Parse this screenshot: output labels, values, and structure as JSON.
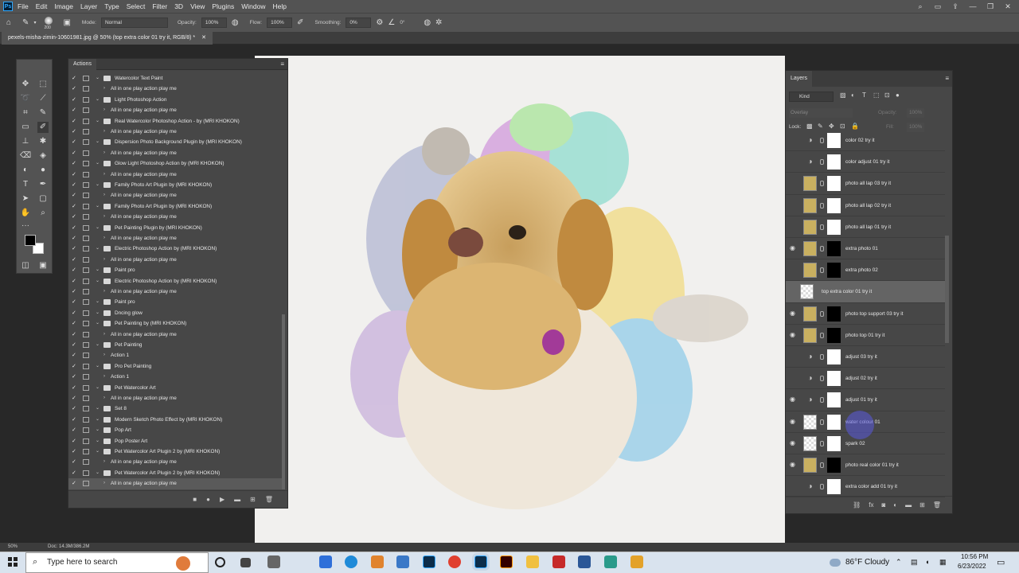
{
  "app": {
    "menu": [
      "File",
      "Edit",
      "Image",
      "Layer",
      "Type",
      "Select",
      "Filter",
      "3D",
      "View",
      "Plugins",
      "Window",
      "Help"
    ]
  },
  "options": {
    "mode_label": "Mode:",
    "mode_value": "Normal",
    "opacity_label": "Opacity:",
    "opacity_value": "100%",
    "flow_label": "Flow:",
    "flow_value": "100%",
    "smoothing_label": "Smoothing:",
    "smoothing_value": "0%",
    "angle_value": "0°",
    "brush_size": "200"
  },
  "document": {
    "tab_title": "pexels-misha-zimin-10601981.jpg @ 50% (top extra color 01 try it, RGB/8) *"
  },
  "actions_panel": {
    "title": "Actions",
    "rows": [
      {
        "label": "Watercolor Text Paint",
        "type": "set",
        "checked": true
      },
      {
        "label": "All in one play action play me",
        "type": "action",
        "checked": true
      },
      {
        "label": "Light Photoshop Action",
        "type": "set",
        "checked": true
      },
      {
        "label": "All in one play action play me",
        "type": "action",
        "checked": true
      },
      {
        "label": "Real Watercolor Photoshop Action - by (MRI KHOKON)",
        "type": "set",
        "checked": true
      },
      {
        "label": "All in one play action play me",
        "type": "action",
        "checked": true
      },
      {
        "label": "Dispersion Photo Background Plugin by (MRI KHOKON)",
        "type": "set",
        "checked": true
      },
      {
        "label": "All in one play action play me",
        "type": "action",
        "checked": true
      },
      {
        "label": "Glow Light Photoshop Action by (MRI KHOKON)",
        "type": "set",
        "checked": true
      },
      {
        "label": "All in one play action play me",
        "type": "action",
        "checked": true
      },
      {
        "label": "Family Photo Art Plugin by (MRI KHOKON)",
        "type": "set",
        "checked": true
      },
      {
        "label": "All in one play action play me",
        "type": "action",
        "checked": true
      },
      {
        "label": "Family Photo Art Plugin by (MRI KHOKON)",
        "type": "set",
        "checked": true
      },
      {
        "label": "All in one play action play me",
        "type": "action",
        "checked": true
      },
      {
        "label": "Pet Painting Plugin by (MRI KHOKON)",
        "type": "set",
        "checked": true
      },
      {
        "label": "All in one play action play me",
        "type": "action",
        "checked": true
      },
      {
        "label": "Electric Photoshop Action by (MRI KHOKON)",
        "type": "set",
        "checked": true
      },
      {
        "label": "All in one play action play me",
        "type": "action",
        "checked": true
      },
      {
        "label": "Paint pro",
        "type": "set",
        "checked": true
      },
      {
        "label": "Electric Photoshop Action by (MRI KHOKON)",
        "type": "set",
        "checked": true
      },
      {
        "label": "All in one play action play me",
        "type": "action",
        "checked": true
      },
      {
        "label": "Paint pro",
        "type": "set",
        "checked": true
      },
      {
        "label": "Dncing glow",
        "type": "set",
        "checked": true
      },
      {
        "label": "Pet Painting by (MRI KHOKON)",
        "type": "set",
        "checked": true
      },
      {
        "label": "All in one play action play me",
        "type": "action",
        "checked": true
      },
      {
        "label": "Pet Painting",
        "type": "set",
        "checked": true
      },
      {
        "label": "Action 1",
        "type": "action",
        "checked": true
      },
      {
        "label": "Pro Pet Painting",
        "type": "set",
        "checked": true
      },
      {
        "label": "Action 1",
        "type": "action",
        "checked": true
      },
      {
        "label": "Pet Watercolor Art",
        "type": "set",
        "checked": true
      },
      {
        "label": "All in one play action play me",
        "type": "action",
        "checked": true
      },
      {
        "label": "Set 8",
        "type": "set",
        "checked": true
      },
      {
        "label": "Modern Sketch Photo Effect by (MRI KHOKON)",
        "type": "set",
        "checked": true
      },
      {
        "label": "Pop Art",
        "type": "set",
        "checked": true
      },
      {
        "label": "Pop Poster Art",
        "type": "set",
        "checked": true
      },
      {
        "label": "Pet Watercolor Art Plugin 2 by (MRI KHOKON)",
        "type": "set",
        "checked": true
      },
      {
        "label": "All in one play action play me",
        "type": "action",
        "checked": true
      },
      {
        "label": "Pet Watercolor Art Plugin 2 by (MRI KHOKON)",
        "type": "set",
        "checked": true
      },
      {
        "label": "All in one play action play me",
        "type": "action",
        "checked": true,
        "selected": true
      }
    ]
  },
  "layers_panel": {
    "title": "Layers",
    "filter_kind": "Kind",
    "blend_mode": "Overlay",
    "opacity_label": "Opacity:",
    "opacity_value": "100%",
    "lock_label": "Lock:",
    "fill_label": "Fill:",
    "fill_value": "100%",
    "layers": [
      {
        "name": "color 02 try it",
        "visible": false,
        "thumb": "adjust",
        "mask": "white"
      },
      {
        "name": "color adjust 01 try it",
        "visible": false,
        "thumb": "adjust",
        "mask": "white"
      },
      {
        "name": "photo all lap 03 try it",
        "visible": false,
        "thumb": "photo",
        "mask": "white"
      },
      {
        "name": "photo all lap 02 try it",
        "visible": false,
        "thumb": "photo",
        "mask": "white"
      },
      {
        "name": "photo all lap 01 try it",
        "visible": false,
        "thumb": "photo",
        "mask": "white"
      },
      {
        "name": "extra photo 01",
        "visible": true,
        "thumb": "photo",
        "mask": "black"
      },
      {
        "name": "extra photo 02",
        "visible": false,
        "thumb": "photo",
        "mask": "black"
      },
      {
        "name": "top extra color 01 try it",
        "visible": false,
        "thumb": "checker",
        "mask": "none",
        "selected": true
      },
      {
        "name": "photo top support 03 try it",
        "visible": true,
        "thumb": "photo",
        "mask": "black"
      },
      {
        "name": "photo top 01 try it",
        "visible": true,
        "thumb": "photo",
        "mask": "black"
      },
      {
        "name": "adjust 03 try it",
        "visible": false,
        "thumb": "adjust",
        "mask": "white"
      },
      {
        "name": "adjust 02 try it",
        "visible": false,
        "thumb": "adjust",
        "mask": "white"
      },
      {
        "name": "adjust 01 try it",
        "visible": true,
        "thumb": "adjust",
        "mask": "white"
      },
      {
        "name": "water colour 01",
        "visible": true,
        "thumb": "checker",
        "mask": "white"
      },
      {
        "name": "spark 02",
        "visible": true,
        "thumb": "checker",
        "mask": "white"
      },
      {
        "name": "photo real color 01 try it",
        "visible": true,
        "thumb": "photo",
        "mask": "black"
      },
      {
        "name": "extra color add 01 try it",
        "visible": false,
        "thumb": "adjust",
        "mask": "white"
      }
    ]
  },
  "status": {
    "zoom": "50%",
    "doc": "Doc: 14.3M/386.2M"
  },
  "taskbar": {
    "search_placeholder": "Type here to search",
    "weather": "86°F  Cloudy",
    "time": "10:56 PM",
    "date": "6/23/2022"
  }
}
